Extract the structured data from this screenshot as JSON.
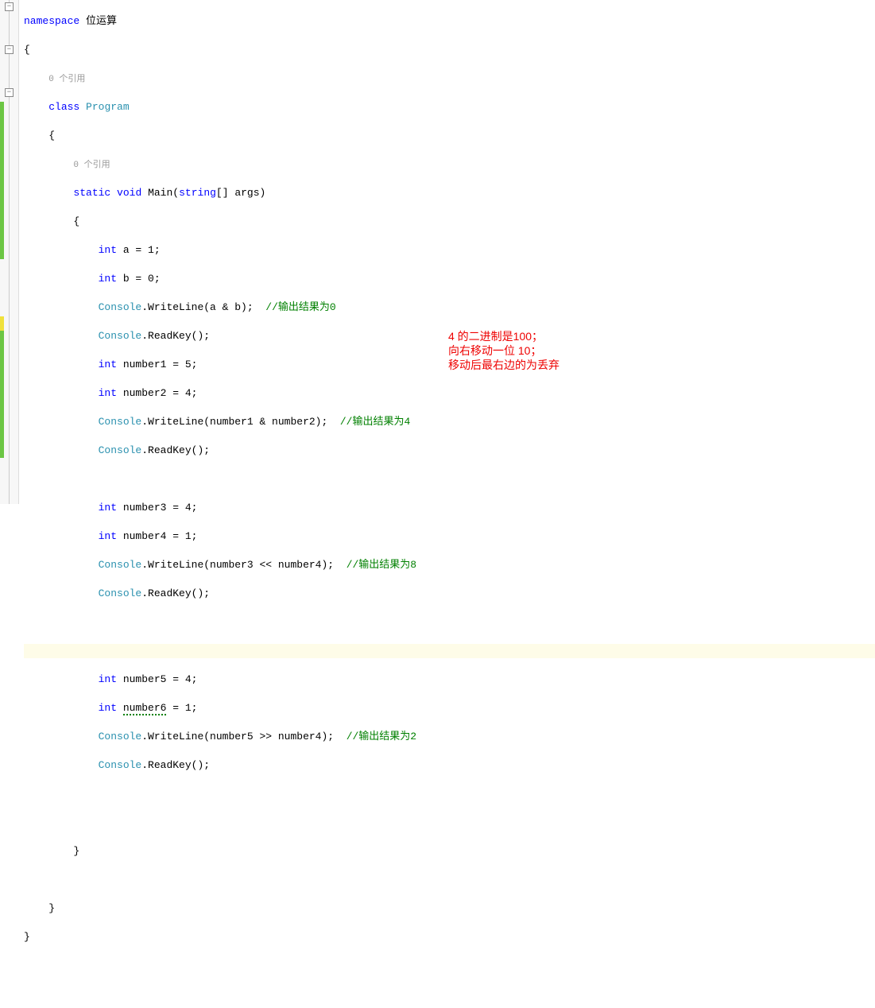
{
  "code": {
    "namespace_kw": "namespace",
    "namespace_name": "位运算",
    "brace_open": "{",
    "brace_close": "}",
    "ref_hint": "0 个引用",
    "class_kw": "class",
    "class_name": "Program",
    "static_kw": "static",
    "void_kw": "void",
    "main": "Main",
    "string_kw": "string",
    "args_decl": "[] args)",
    "paren_open": "(",
    "int_kw": "int",
    "var_a": " a = 1;",
    "var_b": " b = 0;",
    "console": "Console",
    "writeline": ".WriteLine(a & b);  ",
    "comment1": "//输出结果为0",
    "readkey": ".ReadKey();",
    "var_n1": " number1 = 5;",
    "var_n2": " number2 = 4;",
    "writeline2": ".WriteLine(number1 & number2);  ",
    "comment2": "//输出结果为4",
    "var_n3": " number3 = 4;",
    "var_n4": " number4 = 1;",
    "writeline3": ".WriteLine(number3 << number4);  ",
    "comment3": "//输出结果为8",
    "var_n5": " number5 = 4;",
    "var_n6_pre": " ",
    "var_n6_name": "number6",
    "var_n6_post": " = 1;",
    "writeline4": ".WriteLine(number5 >> number4);  ",
    "comment4": "//输出结果为2"
  },
  "annotations": {
    "line1": "4 的二进制是100；",
    "line2": "向右移动一位 10；",
    "line3": "移动后最右边的为丢弃"
  },
  "fold": {
    "minus": "−"
  }
}
